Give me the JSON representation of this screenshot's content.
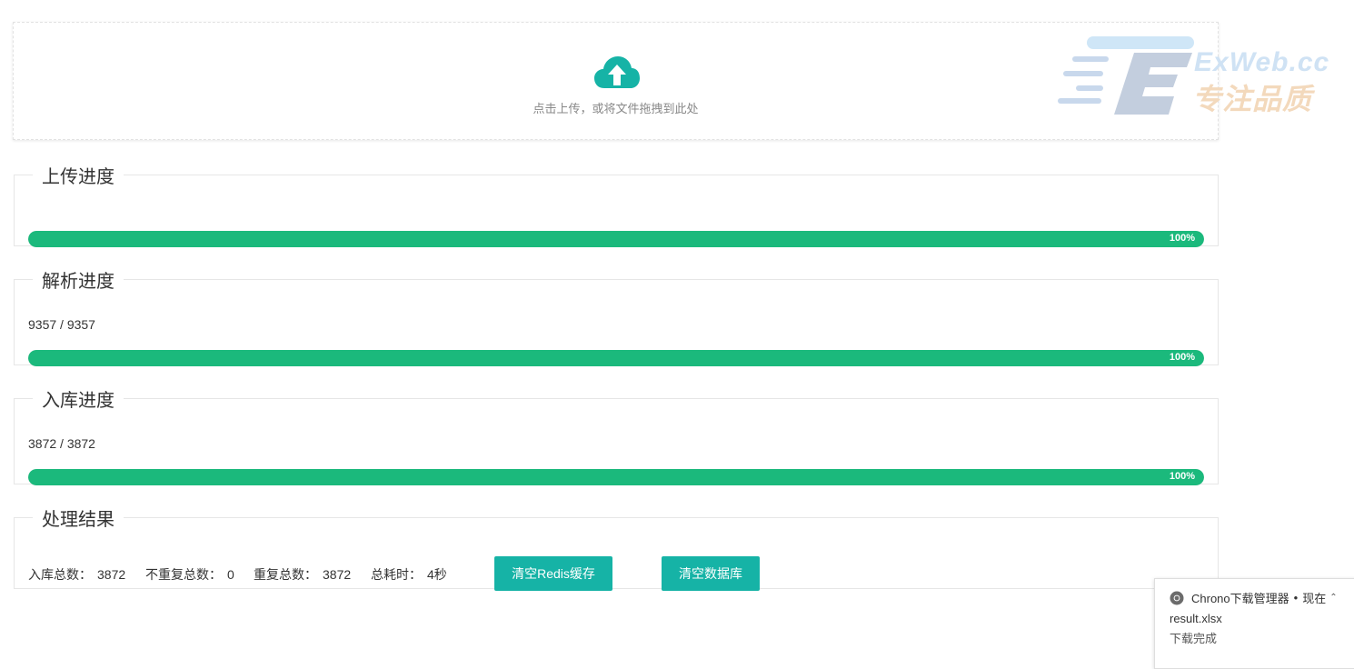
{
  "upload": {
    "icon": "cloud-upload-icon",
    "hint": "点击上传，或将文件拖拽到此处"
  },
  "watermark": {
    "line1": "ExWeb.cc",
    "line2": "专注品质",
    "logo_letter": "E"
  },
  "panels": {
    "upload_progress": {
      "title": "上传进度",
      "percent": 100,
      "percent_label": "100%"
    },
    "parse_progress": {
      "title": "解析进度",
      "count": "9357 / 9357",
      "percent": 100,
      "percent_label": "100%"
    },
    "store_progress": {
      "title": "入库进度",
      "count": "3872 / 3872",
      "percent": 100,
      "percent_label": "100%"
    },
    "result": {
      "title": "处理结果",
      "stats": [
        {
          "label": "入库总数：",
          "value": "3872"
        },
        {
          "label": "不重复总数：",
          "value": "0"
        },
        {
          "label": "重复总数：",
          "value": "3872"
        },
        {
          "label": "总耗时：",
          "value": "4秒"
        }
      ],
      "clear_redis_label": "清空Redis缓存",
      "clear_db_label": "清空数据库"
    }
  },
  "download_popup": {
    "app": "Chrono下载管理器",
    "separator": "•",
    "time": "现在",
    "caret_icon": "chevron-up-icon",
    "file": "result.xlsx",
    "status": "下载完成"
  },
  "colors": {
    "progress": "#1bb97c",
    "button": "#16b3a6",
    "upload_icon": "#16b3a6"
  }
}
